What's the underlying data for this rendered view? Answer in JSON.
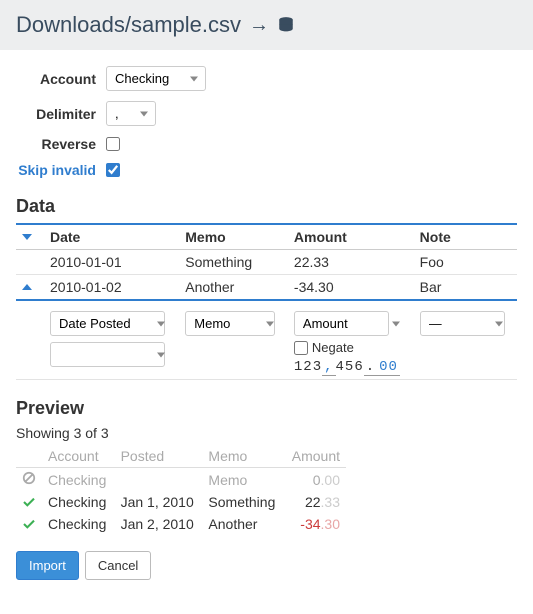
{
  "header": {
    "title": "Downloads/sample.csv"
  },
  "form": {
    "account_label": "Account",
    "account_value": "Checking",
    "delimiter_label": "Delimiter",
    "delimiter_value": ",",
    "reverse_label": "Reverse",
    "reverse_checked": false,
    "skip_invalid_label": "Skip invalid",
    "skip_invalid_checked": true
  },
  "data_section": {
    "title": "Data",
    "columns": {
      "date": "Date",
      "memo": "Memo",
      "amount": "Amount",
      "note": "Note"
    },
    "rows": [
      {
        "date": "2010-01-01",
        "memo": "Something",
        "amount": "22.33",
        "note": "Foo",
        "expanded": false
      },
      {
        "date": "2010-01-02",
        "memo": "Another",
        "amount": "-34.30",
        "note": "Bar",
        "expanded": true
      }
    ],
    "mapping": {
      "date_select": "Date Posted",
      "memo_select": "Memo",
      "amount_select": "Amount",
      "note_select": "—",
      "negate_label": "Negate",
      "sample_a": "123",
      "sample_b": "456",
      "sample_c": "00"
    }
  },
  "preview_section": {
    "title": "Preview",
    "showing": "Showing 3 of 3",
    "columns": {
      "account": "Account",
      "posted": "Posted",
      "memo": "Memo",
      "amount": "Amount"
    },
    "rows": [
      {
        "status": "skip",
        "account": "Checking",
        "posted": "",
        "memo": "Memo",
        "amount_main": "0",
        "amount_dec": ".00",
        "negative": false
      },
      {
        "status": "ok",
        "account": "Checking",
        "posted": "Jan 1, 2010",
        "memo": "Something",
        "amount_main": "22",
        "amount_dec": ".33",
        "negative": false
      },
      {
        "status": "ok",
        "account": "Checking",
        "posted": "Jan 2, 2010",
        "memo": "Another",
        "amount_main": "-34",
        "amount_dec": ".30",
        "negative": true
      }
    ]
  },
  "buttons": {
    "import": "Import",
    "cancel": "Cancel"
  }
}
